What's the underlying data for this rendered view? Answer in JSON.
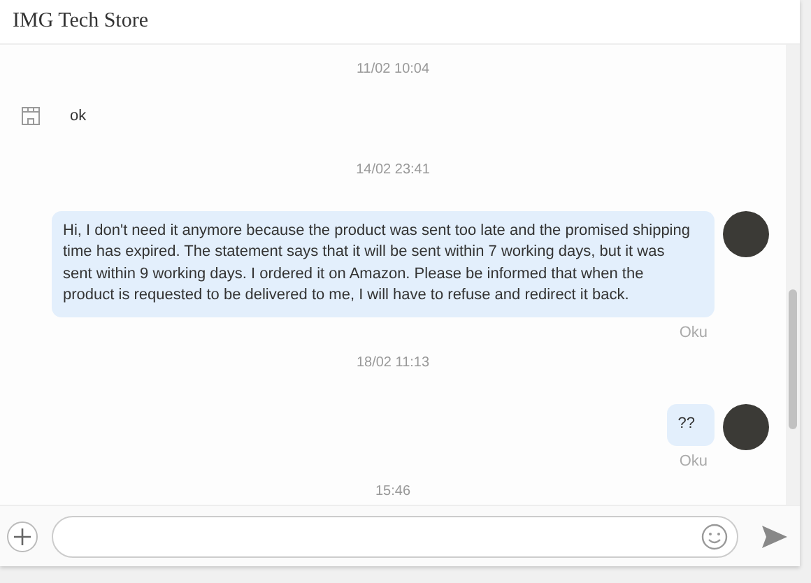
{
  "header": {
    "title": "IMG Tech Store"
  },
  "messages": [
    {
      "kind": "time",
      "text": "11/02 10:04"
    },
    {
      "kind": "incoming",
      "text": "ok"
    },
    {
      "kind": "time",
      "text": "14/02 23:41"
    },
    {
      "kind": "outgoing",
      "text": "Hi, I don't need it anymore because the product was sent too late and the promised shipping time has expired.  The statement says that it will be sent within 7 working days, but it was sent within 9 working days. I ordered it on Amazon. Please be informed that when the product is requested to be delivered to me, I will have to refuse and redirect it back.",
      "status": "Oku"
    },
    {
      "kind": "time",
      "text": "18/02 11:13"
    },
    {
      "kind": "outgoing",
      "text": "??",
      "status": "Oku"
    },
    {
      "kind": "time",
      "text": "15:46"
    }
  ]
}
